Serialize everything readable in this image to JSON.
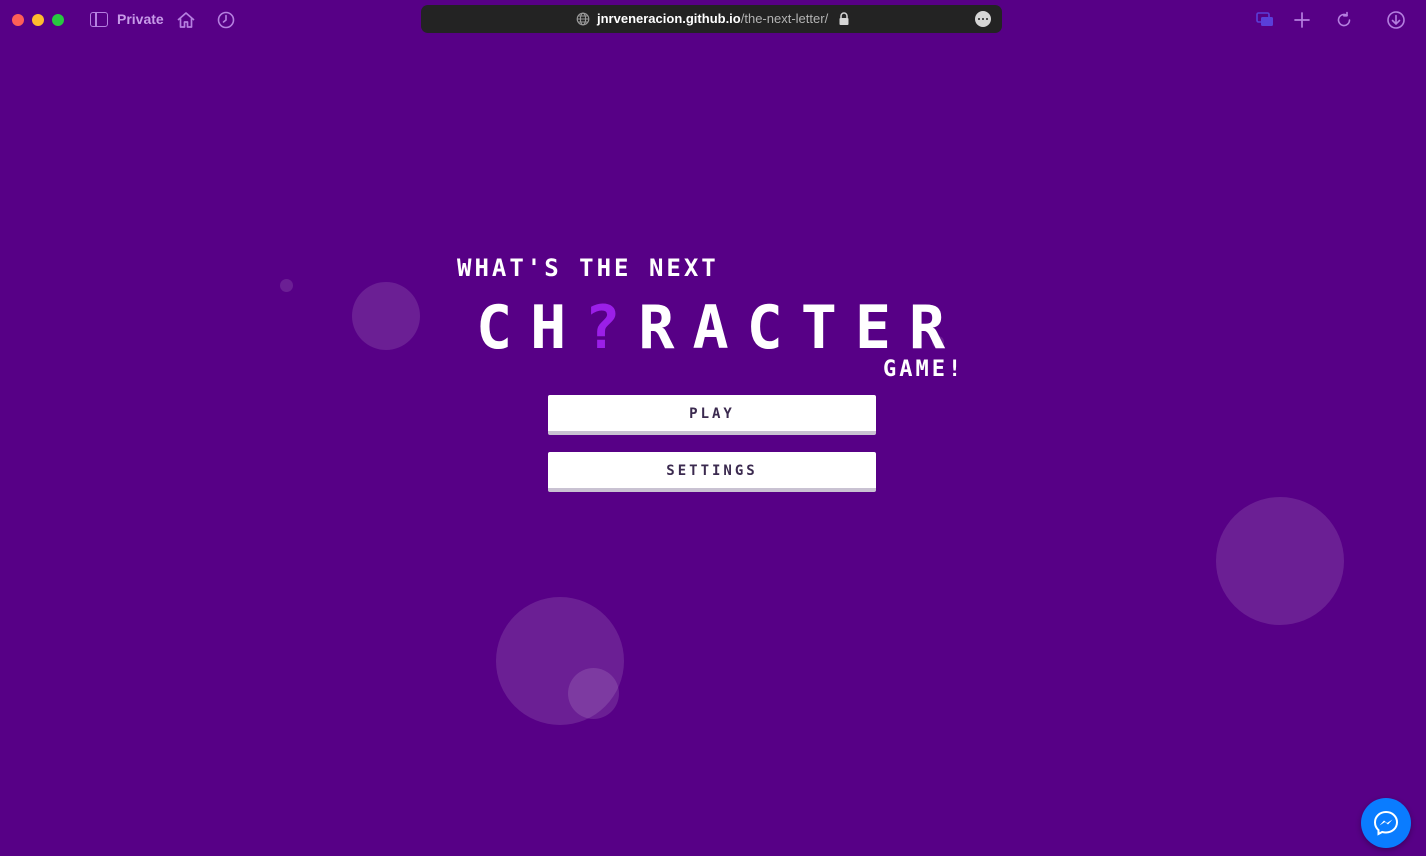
{
  "browser": {
    "private_label": "Private",
    "url_domain": "jnrveneracion.github.io",
    "url_path": "/the-next-letter/",
    "icons": [
      "sidebar-toggle-icon",
      "home-icon",
      "history-icon",
      "globe-icon",
      "lock-icon",
      "more-icon",
      "tab-overview-icon",
      "new-tab-icon",
      "reload-icon",
      "downloads-icon"
    ]
  },
  "game": {
    "title_top": "WHAT'S THE NEXT",
    "title_main_before": "CH",
    "title_main_mark": "?",
    "title_main_after": "RACTER",
    "title_sub": "GAME!",
    "play_label": "PLAY",
    "settings_label": "SETTINGS"
  },
  "colors": {
    "background": "#570086",
    "accent_mark": "#9b1fe8",
    "messenger": "#0a7cff"
  },
  "widgets": {
    "messenger_icon": "messenger-icon"
  }
}
